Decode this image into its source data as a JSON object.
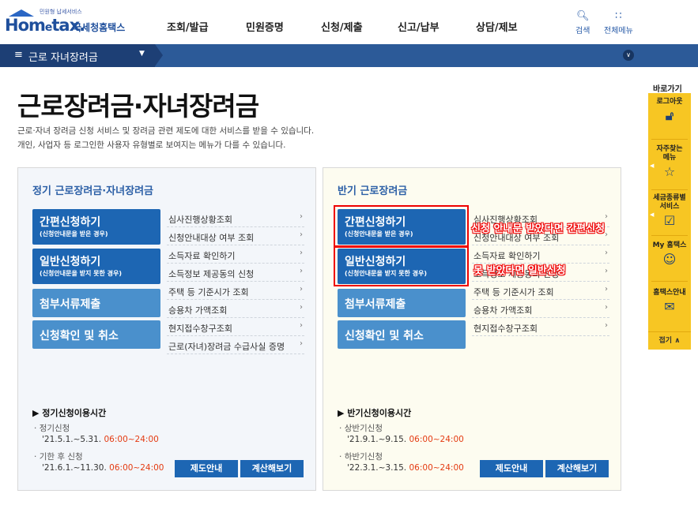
{
  "header": {
    "logo_small": "민원형 납세서비스",
    "logo_brand": "Hom",
    "logo_brand_e": "e",
    "logo_brand_end": "tax.",
    "logo_sub": "국세청홈택스",
    "nav": [
      "조회/발급",
      "민원증명",
      "신청/제출",
      "신고/납부",
      "상담/제보"
    ],
    "search_label": "검색",
    "allmenu_label": "전체메뉴"
  },
  "subbar": {
    "current": "근로 자녀장려금"
  },
  "page": {
    "title": "근로장려금·자녀장려금",
    "desc1": "근로·자녀 장려금 신청 서비스 및 장려금 관련 제도에 대한 서비스를 받을 수 있습니다.",
    "desc2": "개인, 사업자 등 로그인한 사용자 유형별로 보여지는 메뉴가 다를 수 있습니다."
  },
  "left_panel": {
    "title": "정기 근로장려금·자녀장려금",
    "btn_simple": "간편신청하기",
    "btn_simple_sub": "(신청안내문을 받은 경우)",
    "btn_general": "일반신청하기",
    "btn_general_sub": "(신청안내문을 받지 못한 경우)",
    "btn_docs": "첨부서류제출",
    "btn_cancel": "신청확인 및 취소",
    "links": [
      "심사진행상황조회",
      "신청안내대상 여부 조회",
      "소득자료 확인하기",
      "소득정보 제공동의 신청",
      "주택 등 기준시가 조회",
      "승용차 가액조회",
      "현지접수창구조회",
      "근로(자녀)장려금 수급사실 증명"
    ],
    "hours_title": "정기신청이용시간",
    "period1_label": "정기신청",
    "period1_date": "'21.5.1.~5.31.",
    "period1_time": "06:00~24:00",
    "period2_label": "기한 후 신청",
    "period2_date": "'21.6.1.~11.30.",
    "period2_time": "06:00~24:00",
    "btn_info": "제도안내",
    "btn_calc": "계산해보기"
  },
  "right_panel": {
    "title": "반기 근로장려금",
    "btn_simple": "간편신청하기",
    "btn_simple_sub": "(신청안내문을 받은 경우)",
    "btn_general": "일반신청하기",
    "btn_general_sub": "(신청안내문을 받지 못한 경우)",
    "btn_docs": "첨부서류제출",
    "btn_cancel": "신청확인 및 취소",
    "links": [
      "심사진행상황조회",
      "신청안내대상 여부 조회",
      "소득자료 확인하기",
      "소득정보 제공동의 신청",
      "주택 등 기준시가 조회",
      "승용차 가액조회",
      "현지접수창구조회"
    ],
    "hours_title": "반기신청이용시간",
    "period1_label": "상반기신청",
    "period1_date": "'21.9.1.~9.15.",
    "period1_time": "06:00~24:00",
    "period2_label": "하반기신청",
    "period2_date": "'22.3.1.~3.15.",
    "period2_time": "06:00~24:00",
    "btn_info": "제도안내",
    "btn_calc": "계산해보기"
  },
  "annotations": {
    "simple": "신청 안내문 받았다면 간편신청",
    "general": "못 받았다면 일반신청"
  },
  "quickmenu": {
    "title": "바로가기",
    "items": [
      {
        "label1": "로그아웃",
        "label2": "",
        "icon": "lock-icon"
      },
      {
        "label1": "자주찾는",
        "label2": "메뉴",
        "icon": "star-icon"
      },
      {
        "label1": "세금종류별",
        "label2": "서비스",
        "icon": "check-box-icon"
      },
      {
        "label1": "My 홈택스",
        "label2": "",
        "icon": "person-icon"
      },
      {
        "label1": "홈택스안내",
        "label2": "",
        "icon": "guide-icon"
      }
    ],
    "close": "접기"
  },
  "colors": {
    "brand_blue": "#1d66b3",
    "light_blue": "#4a90cc",
    "nav_bar": "#2c5a98",
    "quick_yellow": "#f7c623",
    "time_red": "#e43b12",
    "annotation_red": "#ee0000"
  }
}
